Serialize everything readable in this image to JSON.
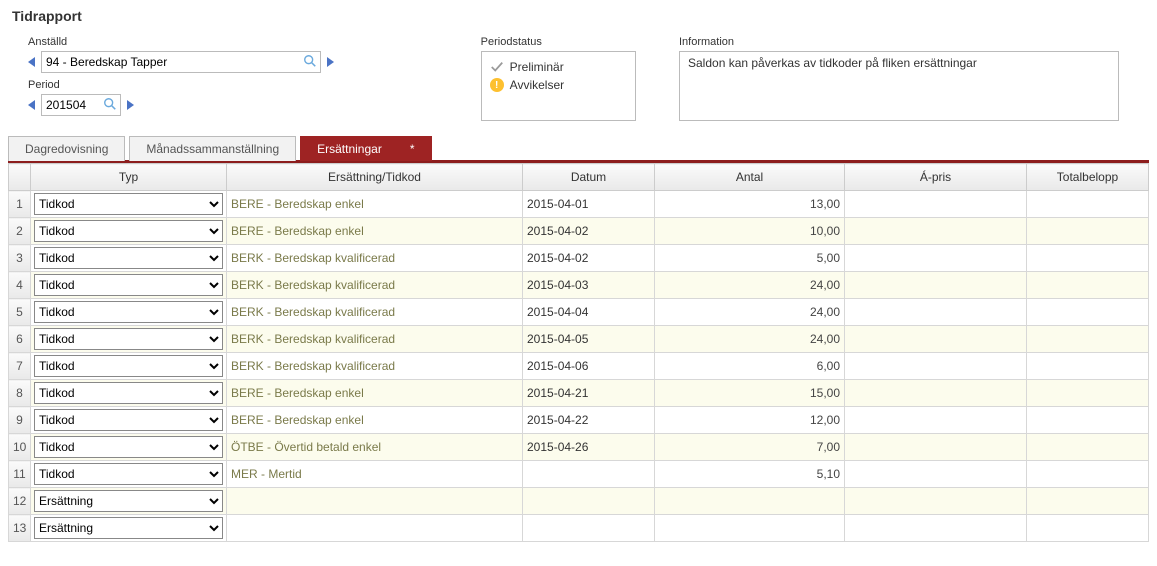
{
  "page_title": "Tidrapport",
  "employee": {
    "label": "Anställd",
    "value": "94 - Beredskap Tapper"
  },
  "period": {
    "label": "Period",
    "value": "201504"
  },
  "periodstatus": {
    "label": "Periodstatus",
    "items": [
      {
        "icon": "check",
        "text": "Preliminär"
      },
      {
        "icon": "warn",
        "text": "Avvikelser"
      }
    ]
  },
  "information": {
    "label": "Information",
    "text": "Saldon kan påverkas av tidkoder på fliken ersättningar"
  },
  "tabs": [
    {
      "label": "Dagredovisning",
      "active": false
    },
    {
      "label": "Månadssammanställning",
      "active": false
    },
    {
      "label": "Ersättningar",
      "active": true,
      "dirty": "*"
    }
  ],
  "columns": {
    "typ": "Typ",
    "code": "Ersättning/Tidkod",
    "datum": "Datum",
    "antal": "Antal",
    "apris": "Á-pris",
    "total": "Totalbelopp"
  },
  "type_options": [
    "Tidkod",
    "Ersättning"
  ],
  "rows": [
    {
      "n": "1",
      "typ": "Tidkod",
      "code": "BERE - Beredskap enkel",
      "datum": "2015-04-01",
      "antal": "13,00",
      "apris": "",
      "total": ""
    },
    {
      "n": "2",
      "typ": "Tidkod",
      "code": "BERE - Beredskap enkel",
      "datum": "2015-04-02",
      "antal": "10,00",
      "apris": "",
      "total": ""
    },
    {
      "n": "3",
      "typ": "Tidkod",
      "code": "BERK - Beredskap kvalificerad",
      "datum": "2015-04-02",
      "antal": "5,00",
      "apris": "",
      "total": ""
    },
    {
      "n": "4",
      "typ": "Tidkod",
      "code": "BERK - Beredskap kvalificerad",
      "datum": "2015-04-03",
      "antal": "24,00",
      "apris": "",
      "total": ""
    },
    {
      "n": "5",
      "typ": "Tidkod",
      "code": "BERK - Beredskap kvalificerad",
      "datum": "2015-04-04",
      "antal": "24,00",
      "apris": "",
      "total": ""
    },
    {
      "n": "6",
      "typ": "Tidkod",
      "code": "BERK - Beredskap kvalificerad",
      "datum": "2015-04-05",
      "antal": "24,00",
      "apris": "",
      "total": ""
    },
    {
      "n": "7",
      "typ": "Tidkod",
      "code": "BERK - Beredskap kvalificerad",
      "datum": "2015-04-06",
      "antal": "6,00",
      "apris": "",
      "total": ""
    },
    {
      "n": "8",
      "typ": "Tidkod",
      "code": "BERE - Beredskap enkel",
      "datum": "2015-04-21",
      "antal": "15,00",
      "apris": "",
      "total": ""
    },
    {
      "n": "9",
      "typ": "Tidkod",
      "code": "BERE - Beredskap enkel",
      "datum": "2015-04-22",
      "antal": "12,00",
      "apris": "",
      "total": ""
    },
    {
      "n": "10",
      "typ": "Tidkod",
      "code": "ÖTBE - Övertid betald enkel",
      "datum": "2015-04-26",
      "antal": "7,00",
      "apris": "",
      "total": ""
    },
    {
      "n": "11",
      "typ": "Tidkod",
      "code": "MER - Mertid",
      "datum": "",
      "antal": "5,10",
      "apris": "",
      "total": ""
    },
    {
      "n": "12",
      "typ": "Ersättning",
      "code": "",
      "datum": "",
      "antal": "",
      "apris": "",
      "total": ""
    },
    {
      "n": "13",
      "typ": "Ersättning",
      "code": "",
      "datum": "",
      "antal": "",
      "apris": "",
      "total": ""
    }
  ]
}
